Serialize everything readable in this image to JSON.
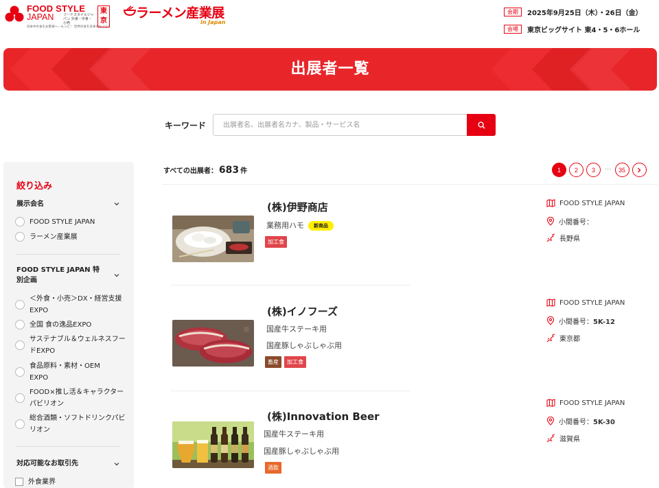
{
  "header": {
    "fsj_logo_title": "FOOD STYLE",
    "fsj_logo_sub": "JAPAN",
    "fsj_logo_small": "フードスタイルジャパン 外食・中食・小売",
    "fsj_logo_tag": "東京",
    "fsj_logo_tagline": "日本中の食をお客様へ—もっと！ 世界の食を日本のもっと！",
    "ramen_logo": "ラーメン産業展",
    "ramen_logo_sub": "in Japan",
    "period_badge": "会期",
    "period_text": "2025年9月25日（木）・26日（金）",
    "venue_badge": "会場",
    "venue_text": "東京ビッグサイト 東4・5・6ホール"
  },
  "banner": {
    "title": "出展者一覧"
  },
  "search": {
    "label": "キーワード",
    "placeholder": "出展者名、出展者名カナ、製品・サービス名"
  },
  "sidebar": {
    "title": "絞り込み",
    "sections": [
      {
        "title": "展示会名",
        "items": [
          "FOOD STYLE JAPAN",
          "ラーメン産業展"
        ]
      },
      {
        "title": "FOOD STYLE JAPAN 特別企画",
        "items": [
          "＜外食・小売＞DX・経営支援EXPO",
          "全国 食の逸品EXPO",
          "サステナブル＆ウェルネスフードEXPO",
          "食品原料・素材・OEM EXPO",
          "FOOD×推し活＆キャラクターパビリオン",
          "総合酒類・ソフトドリンクパビリオン"
        ]
      },
      {
        "title": "対応可能なお取引先",
        "items": [
          "外食業界"
        ]
      }
    ]
  },
  "results": {
    "count_label": "すべての出展者：",
    "count_value": "683",
    "count_unit": "件",
    "pages": [
      "1",
      "2",
      "3",
      "35"
    ],
    "ellipsis": "···",
    "current_page": "1"
  },
  "exhibitors": [
    {
      "name": "(株)伊野商店",
      "products": [
        "業務用ハモ"
      ],
      "new_badge": "新商品",
      "tags": [
        {
          "label": "加工食",
          "color": "#e0454a"
        }
      ],
      "exhibition": "FOOD STYLE JAPAN",
      "booth_label": "小間番号：",
      "booth": "",
      "prefecture": "長野県"
    },
    {
      "name": "(株)イノフーズ",
      "products": [
        "国産牛ステーキ用",
        "国産豚しゃぶしゃぶ用"
      ],
      "tags": [
        {
          "label": "畜産",
          "color": "#8a4b2a"
        },
        {
          "label": "加工食",
          "color": "#e0454a"
        }
      ],
      "exhibition": "FOOD STYLE JAPAN",
      "booth_label": "小間番号：",
      "booth": "5K-12",
      "prefecture": "東京都"
    },
    {
      "name": "(株)Innovation Beer",
      "products": [
        "国産牛ステーキ用",
        "国産豚しゃぶしゃぶ用"
      ],
      "tags": [
        {
          "label": "酒飲",
          "color": "#e8672a"
        }
      ],
      "exhibition": "FOOD STYLE JAPAN",
      "booth_label": "小間番号：",
      "booth": "5K-30",
      "prefecture": "滋賀県"
    }
  ]
}
